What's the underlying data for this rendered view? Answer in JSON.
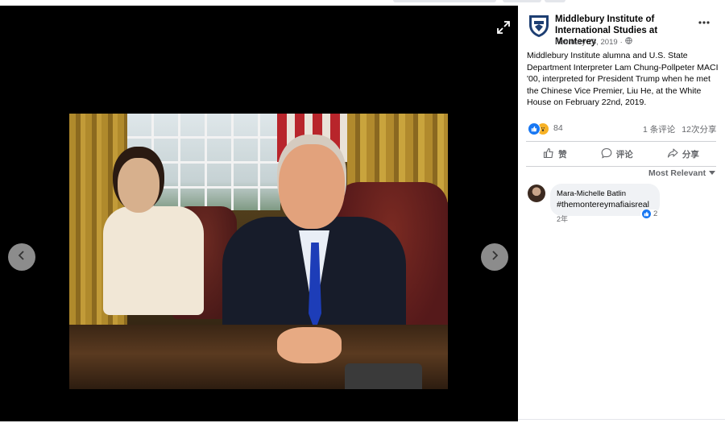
{
  "post": {
    "page_name": "Middlebury Institute of International Studies at Monterey",
    "date": "February 25, 2019",
    "date_separator": "·",
    "text": "Middlebury Institute alumna and U.S. State Department Interpreter Lam Chung-Pollpeter MACI '00, interpreted for President Trump when he met the Chinese Vice Premier, Liu He, at the White House on February 22nd, 2019.",
    "reaction_count": "84",
    "comment_count": "1 条评论",
    "share_count": "12次分享"
  },
  "actions": {
    "like": "赞",
    "comment": "评论",
    "share": "分享"
  },
  "comments": {
    "sort_label": "Most Relevant",
    "items": [
      {
        "author": "Mara-Michelle Batlin",
        "text": "#themontereymafiaisreal",
        "likes": "2",
        "time": "2年"
      }
    ]
  },
  "icons": {
    "expand": "expand-icon",
    "prev": "chevron-left-icon",
    "next": "chevron-right-icon",
    "more": "more-options-icon",
    "globe": "globe-icon",
    "like": "thumbs-up-icon",
    "comment": "comment-icon",
    "share": "share-icon",
    "sort": "caret-down-icon"
  },
  "colors": {
    "viewer_bg": "#000000",
    "brand_blue": "#1877f2",
    "text_secondary": "#65676b"
  }
}
